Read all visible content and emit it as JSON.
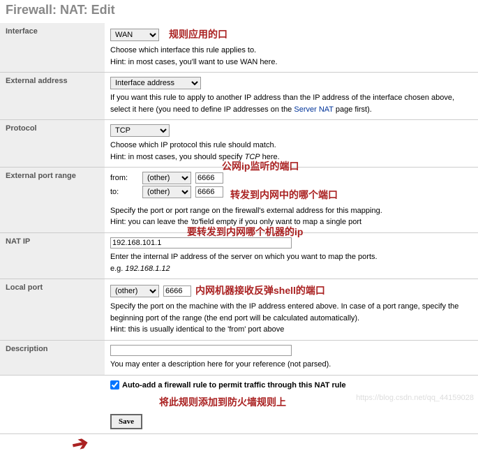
{
  "title": "Firewall: NAT: Edit",
  "rows": {
    "interface": {
      "label": "Interface",
      "value": "WAN",
      "anno": "规则应用的口",
      "hint1": "Choose which interface this rule applies to.",
      "hint2": "Hint: in most cases, you'll want to use WAN here."
    },
    "ext_addr": {
      "label": "External address",
      "value": "Interface address",
      "hint1": "If you want this rule to apply to another IP address than the IP address of the interface chosen above, select it here (you need to define IP addresses on the ",
      "link": "Server NAT",
      "hint_after": " page first)."
    },
    "protocol": {
      "label": "Protocol",
      "value": "TCP",
      "hint1": "Choose which IP protocol this rule should match.",
      "hint2_a": "Hint: in most cases, you should specify ",
      "hint2_i": "TCP",
      "hint2_b": " here."
    },
    "ext_port": {
      "label": "External port range",
      "from_lbl": "from:",
      "to_lbl": "to:",
      "sel": "(other)",
      "from_val": "6666",
      "to_val": "6666",
      "anno_top": "公网ip监听的端口",
      "anno1": "转发到内网中的哪个端口",
      "hint1": "Specify the port or port range on the firewall's external address for this mapping.",
      "hint2_a": "Hint: you can leave the ",
      "hint2_i": "'to'",
      "hint2_b": "field empty if you only want to map a single port"
    },
    "nat_ip": {
      "label": "NAT IP",
      "value": "192.168.101.1",
      "anno": "要转发到内网哪个机器的ip",
      "hint1": "Enter the internal IP address of the server on which you want to map the ports.",
      "hint2_a": "e.g. ",
      "hint2_i": "192.168.1.12"
    },
    "local_port": {
      "label": "Local port",
      "sel": "(other)",
      "val": "6666",
      "anno": "内网机器接收反弹shell的端口",
      "hint1": "Specify the port on the machine with the IP address entered above. In case of a port range, specify the beginning port of the range (the end port will be calculated automatically).",
      "hint2": "Hint: this is usually identical to the 'from' port above"
    },
    "description": {
      "label": "Description",
      "value": "",
      "hint": "You may enter a description here for your reference (not parsed)."
    }
  },
  "bottom": {
    "chk_label": "Auto-add a firewall rule to permit traffic through this NAT rule",
    "anno": "将此规则添加到防火墙规则上",
    "save": "Save"
  },
  "watermark": "https://blog.csdn.net/qq_44159028"
}
